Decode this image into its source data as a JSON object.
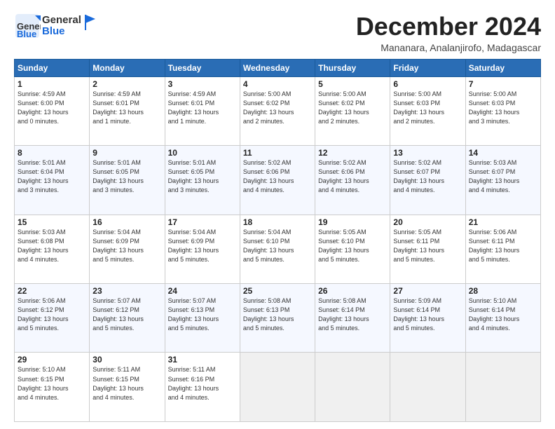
{
  "header": {
    "logo_general": "General",
    "logo_blue": "Blue",
    "month_title": "December 2024",
    "location": "Mananara, Analanjirofo, Madagascar"
  },
  "days_of_week": [
    "Sunday",
    "Monday",
    "Tuesday",
    "Wednesday",
    "Thursday",
    "Friday",
    "Saturday"
  ],
  "weeks": [
    [
      {
        "day": 1,
        "info": "Sunrise: 4:59 AM\nSunset: 6:00 PM\nDaylight: 13 hours\nand 0 minutes."
      },
      {
        "day": 2,
        "info": "Sunrise: 4:59 AM\nSunset: 6:01 PM\nDaylight: 13 hours\nand 1 minute."
      },
      {
        "day": 3,
        "info": "Sunrise: 4:59 AM\nSunset: 6:01 PM\nDaylight: 13 hours\nand 1 minute."
      },
      {
        "day": 4,
        "info": "Sunrise: 5:00 AM\nSunset: 6:02 PM\nDaylight: 13 hours\nand 2 minutes."
      },
      {
        "day": 5,
        "info": "Sunrise: 5:00 AM\nSunset: 6:02 PM\nDaylight: 13 hours\nand 2 minutes."
      },
      {
        "day": 6,
        "info": "Sunrise: 5:00 AM\nSunset: 6:03 PM\nDaylight: 13 hours\nand 2 minutes."
      },
      {
        "day": 7,
        "info": "Sunrise: 5:00 AM\nSunset: 6:03 PM\nDaylight: 13 hours\nand 3 minutes."
      }
    ],
    [
      {
        "day": 8,
        "info": "Sunrise: 5:01 AM\nSunset: 6:04 PM\nDaylight: 13 hours\nand 3 minutes."
      },
      {
        "day": 9,
        "info": "Sunrise: 5:01 AM\nSunset: 6:05 PM\nDaylight: 13 hours\nand 3 minutes."
      },
      {
        "day": 10,
        "info": "Sunrise: 5:01 AM\nSunset: 6:05 PM\nDaylight: 13 hours\nand 3 minutes."
      },
      {
        "day": 11,
        "info": "Sunrise: 5:02 AM\nSunset: 6:06 PM\nDaylight: 13 hours\nand 4 minutes."
      },
      {
        "day": 12,
        "info": "Sunrise: 5:02 AM\nSunset: 6:06 PM\nDaylight: 13 hours\nand 4 minutes."
      },
      {
        "day": 13,
        "info": "Sunrise: 5:02 AM\nSunset: 6:07 PM\nDaylight: 13 hours\nand 4 minutes."
      },
      {
        "day": 14,
        "info": "Sunrise: 5:03 AM\nSunset: 6:07 PM\nDaylight: 13 hours\nand 4 minutes."
      }
    ],
    [
      {
        "day": 15,
        "info": "Sunrise: 5:03 AM\nSunset: 6:08 PM\nDaylight: 13 hours\nand 4 minutes."
      },
      {
        "day": 16,
        "info": "Sunrise: 5:04 AM\nSunset: 6:09 PM\nDaylight: 13 hours\nand 5 minutes."
      },
      {
        "day": 17,
        "info": "Sunrise: 5:04 AM\nSunset: 6:09 PM\nDaylight: 13 hours\nand 5 minutes."
      },
      {
        "day": 18,
        "info": "Sunrise: 5:04 AM\nSunset: 6:10 PM\nDaylight: 13 hours\nand 5 minutes."
      },
      {
        "day": 19,
        "info": "Sunrise: 5:05 AM\nSunset: 6:10 PM\nDaylight: 13 hours\nand 5 minutes."
      },
      {
        "day": 20,
        "info": "Sunrise: 5:05 AM\nSunset: 6:11 PM\nDaylight: 13 hours\nand 5 minutes."
      },
      {
        "day": 21,
        "info": "Sunrise: 5:06 AM\nSunset: 6:11 PM\nDaylight: 13 hours\nand 5 minutes."
      }
    ],
    [
      {
        "day": 22,
        "info": "Sunrise: 5:06 AM\nSunset: 6:12 PM\nDaylight: 13 hours\nand 5 minutes."
      },
      {
        "day": 23,
        "info": "Sunrise: 5:07 AM\nSunset: 6:12 PM\nDaylight: 13 hours\nand 5 minutes."
      },
      {
        "day": 24,
        "info": "Sunrise: 5:07 AM\nSunset: 6:13 PM\nDaylight: 13 hours\nand 5 minutes."
      },
      {
        "day": 25,
        "info": "Sunrise: 5:08 AM\nSunset: 6:13 PM\nDaylight: 13 hours\nand 5 minutes."
      },
      {
        "day": 26,
        "info": "Sunrise: 5:08 AM\nSunset: 6:14 PM\nDaylight: 13 hours\nand 5 minutes."
      },
      {
        "day": 27,
        "info": "Sunrise: 5:09 AM\nSunset: 6:14 PM\nDaylight: 13 hours\nand 5 minutes."
      },
      {
        "day": 28,
        "info": "Sunrise: 5:10 AM\nSunset: 6:14 PM\nDaylight: 13 hours\nand 4 minutes."
      }
    ],
    [
      {
        "day": 29,
        "info": "Sunrise: 5:10 AM\nSunset: 6:15 PM\nDaylight: 13 hours\nand 4 minutes."
      },
      {
        "day": 30,
        "info": "Sunrise: 5:11 AM\nSunset: 6:15 PM\nDaylight: 13 hours\nand 4 minutes."
      },
      {
        "day": 31,
        "info": "Sunrise: 5:11 AM\nSunset: 6:16 PM\nDaylight: 13 hours\nand 4 minutes."
      },
      null,
      null,
      null,
      null
    ]
  ]
}
